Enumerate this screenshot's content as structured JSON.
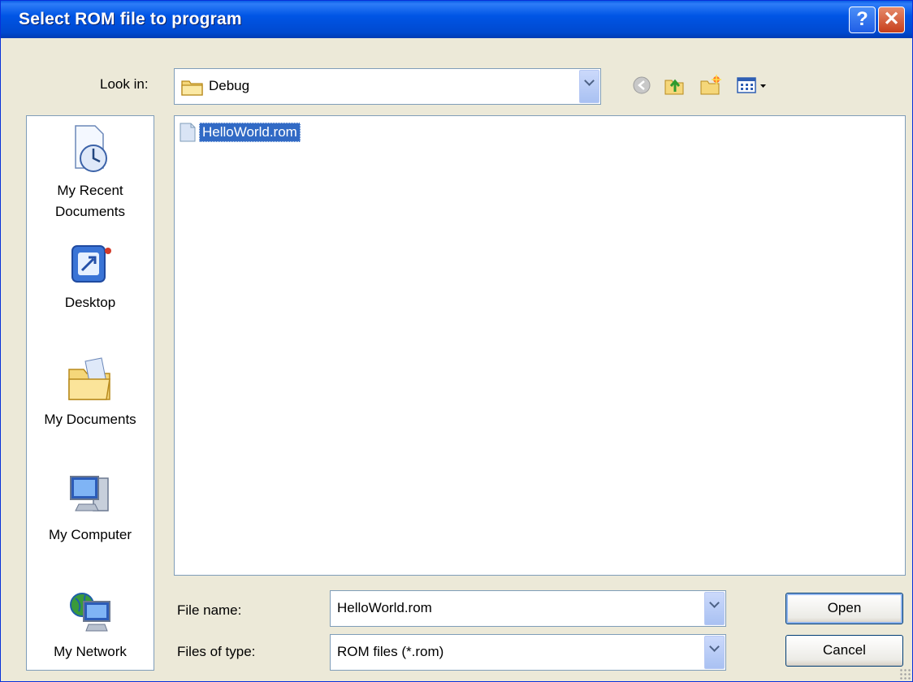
{
  "window": {
    "title": "Select ROM file to program"
  },
  "lookin": {
    "label": "Look in:",
    "value": "Debug"
  },
  "places": [
    {
      "line1": "My Recent",
      "line2": "Documents"
    },
    {
      "line1": "Desktop"
    },
    {
      "line1": "My Documents"
    },
    {
      "line1": "My Computer"
    },
    {
      "line1": "My Network"
    }
  ],
  "files": [
    {
      "name": "HelloWorld.rom"
    }
  ],
  "filename": {
    "label": "File name:",
    "value": "HelloWorld.rom"
  },
  "filetype": {
    "label": "Files of type:",
    "value": "ROM files (*.rom)"
  },
  "buttons": {
    "open": "Open",
    "cancel": "Cancel"
  },
  "icons": {
    "help": "?",
    "close": "✕",
    "back": "back-arrow-icon",
    "up": "up-folder-icon",
    "new_folder": "new-folder-icon",
    "views": "views-menu-icon"
  },
  "colors": {
    "title_bar": "#0055e5",
    "selection": "#316ac5",
    "dialog_bg": "#ece9d8"
  }
}
